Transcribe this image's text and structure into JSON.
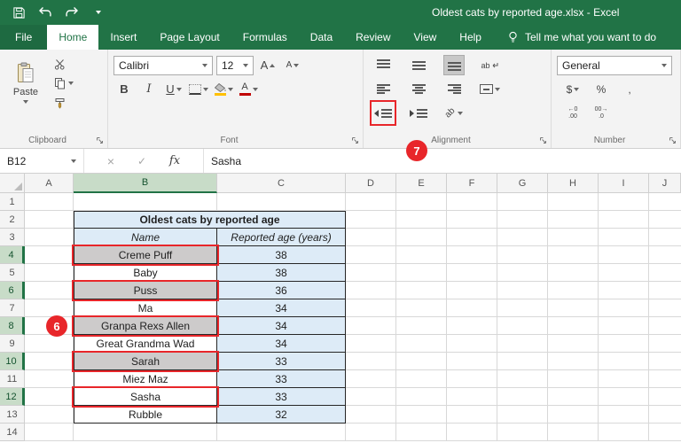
{
  "window": {
    "title": "Oldest cats by reported age.xlsx - Excel"
  },
  "tabs": {
    "items": [
      "File",
      "Home",
      "Insert",
      "Page Layout",
      "Formulas",
      "Data",
      "Review",
      "View",
      "Help"
    ],
    "active": "Home",
    "tell_me": "Tell me what you want to do"
  },
  "ribbon": {
    "clipboard": {
      "label": "Clipboard",
      "paste": "Paste"
    },
    "font": {
      "label": "Font",
      "family": "Calibri",
      "size": "12",
      "bold": "B",
      "italic": "I",
      "underline": "U",
      "grow_font": "A",
      "shrink_font": "A"
    },
    "alignment": {
      "label": "Alignment",
      "wrap_text": "ab",
      "orientation": "ab"
    },
    "number": {
      "label": "Number",
      "format": "General",
      "currency": "$",
      "percent": "%",
      "comma": ",",
      "inc_decimal_top": "←0",
      "inc_decimal_bottom": ".00",
      "dec_decimal_top": "00→",
      "dec_decimal_bottom": ".0"
    }
  },
  "formula_bar": {
    "cell_ref": "B12",
    "cancel": "×",
    "enter": "✓",
    "fx": "fx",
    "value": "Sasha"
  },
  "annotations": {
    "step_6": "6",
    "step_7": "7",
    "red": "#E8262A"
  },
  "sheet": {
    "col_headers": [
      "A",
      "B",
      "C",
      "D",
      "E",
      "F",
      "G",
      "H",
      "I",
      "J"
    ],
    "row_headers": [
      "1",
      "2",
      "3",
      "4",
      "5",
      "6",
      "7",
      "8",
      "9",
      "10",
      "11",
      "12",
      "13",
      "14"
    ],
    "selected_cell": "B12",
    "selected_cells": [
      "B4",
      "B6",
      "B8",
      "B10",
      "B12"
    ],
    "table": {
      "title": "Oldest cats by reported age",
      "col_name": "Name",
      "col_age": "Reported age (years)",
      "entries": [
        {
          "name": "Creme Puff",
          "age": "38"
        },
        {
          "name": "Baby",
          "age": "38"
        },
        {
          "name": "Puss",
          "age": "36"
        },
        {
          "name": "Ma",
          "age": "34"
        },
        {
          "name": "Granpa Rexs Allen",
          "age": "34"
        },
        {
          "name": "Great Grandma Wad",
          "age": "34"
        },
        {
          "name": "Sarah",
          "age": "33"
        },
        {
          "name": "Miez Maz",
          "age": "33"
        },
        {
          "name": "Sasha",
          "age": "33"
        },
        {
          "name": "Rubble",
          "age": "32"
        }
      ]
    }
  },
  "colors": {
    "excel_green": "#217346",
    "table_fill_blue": "#DDEBF7",
    "selection_gray": "#CDCBCB",
    "annotation_red": "#E8262A",
    "font_color_swatch": "#C00000",
    "fill_color_swatch": "#FFC000"
  }
}
